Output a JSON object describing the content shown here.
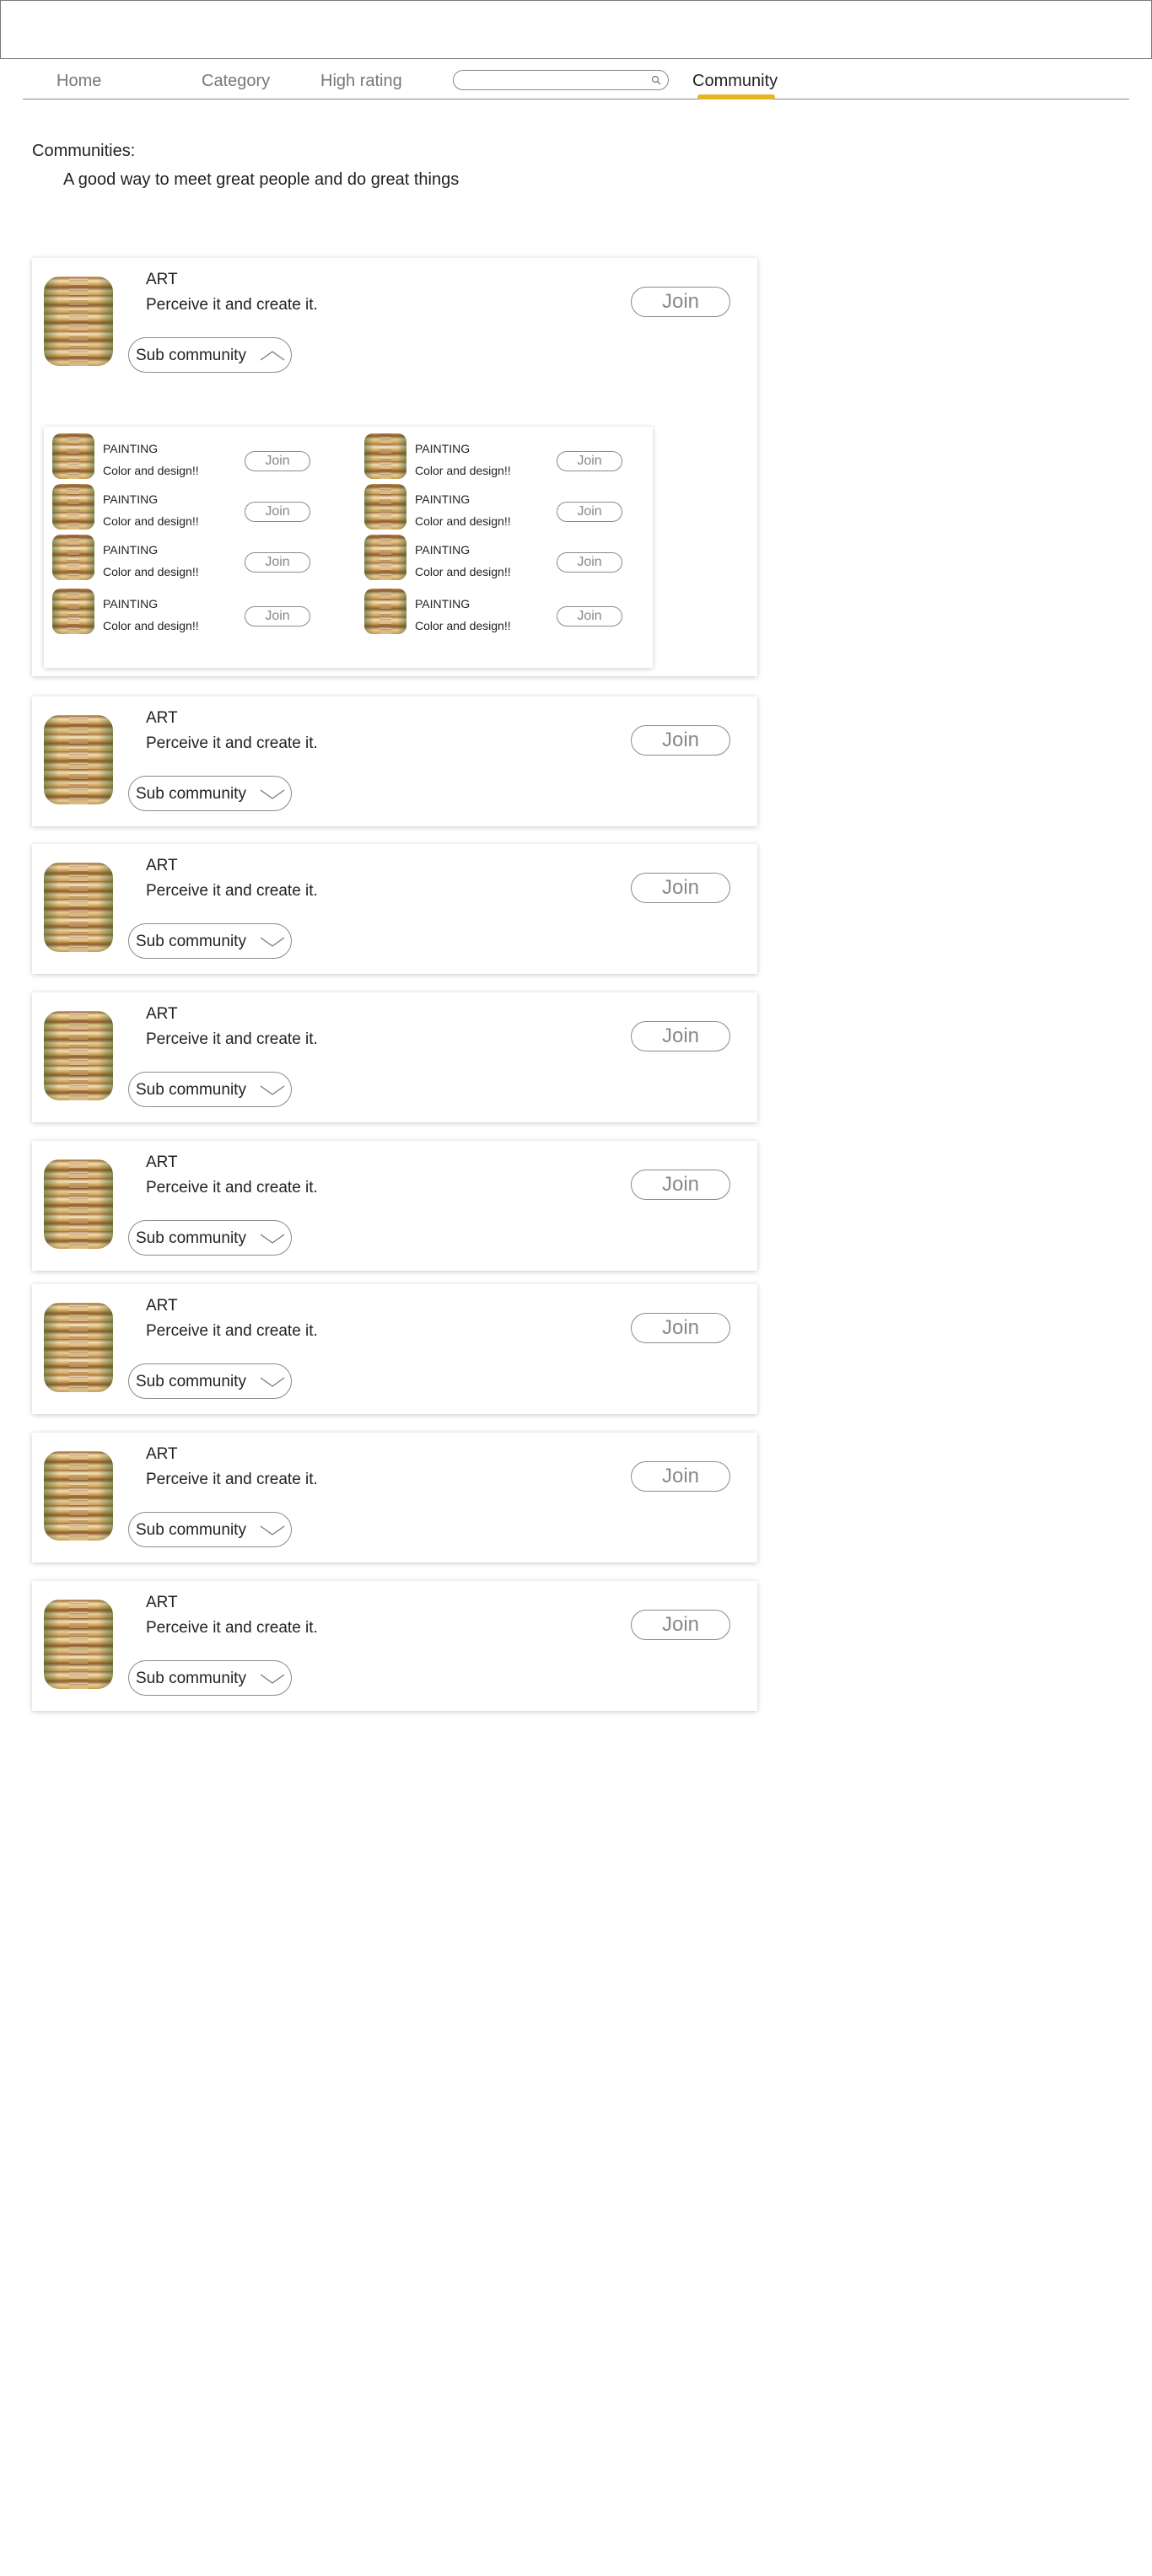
{
  "nav": {
    "items": [
      {
        "label": "Home",
        "name": "nav-home"
      },
      {
        "label": "Category",
        "name": "nav-category"
      },
      {
        "label": "High rating",
        "name": "nav-high-rating"
      },
      {
        "label": "Community",
        "name": "nav-community"
      }
    ],
    "active": "Community",
    "search": {
      "value": "",
      "placeholder": "",
      "icon": "search-icon"
    },
    "accent_color": "#e7b524"
  },
  "page": {
    "title": "Communities:",
    "subtitle": "A good way to meet great people and do great things"
  },
  "communities": [
    {
      "title": "ART",
      "description": "Perceive it and create it.",
      "join_label": "Join",
      "sub_label": "Sub community",
      "expanded": true,
      "chevron": "chevron-up-icon"
    },
    {
      "title": "ART",
      "description": "Perceive it and create it.",
      "join_label": "Join",
      "sub_label": "Sub community",
      "expanded": false,
      "chevron": "chevron-down-icon"
    },
    {
      "title": "ART",
      "description": "Perceive it and create it.",
      "join_label": "Join",
      "sub_label": "Sub community",
      "expanded": false,
      "chevron": "chevron-down-icon"
    },
    {
      "title": "ART",
      "description": "Perceive it and create it.",
      "join_label": "Join",
      "sub_label": "Sub community",
      "expanded": false,
      "chevron": "chevron-down-icon"
    },
    {
      "title": "ART",
      "description": "Perceive it and create it.",
      "join_label": "Join",
      "sub_label": "Sub community",
      "expanded": false,
      "chevron": "chevron-down-icon"
    },
    {
      "title": "ART",
      "description": "Perceive it and create it.",
      "join_label": "Join",
      "sub_label": "Sub community",
      "expanded": false,
      "chevron": "chevron-down-icon"
    },
    {
      "title": "ART",
      "description": "Perceive it and create it.",
      "join_label": "Join",
      "sub_label": "Sub community",
      "expanded": false,
      "chevron": "chevron-down-icon"
    },
    {
      "title": "ART",
      "description": "Perceive it and create it.",
      "join_label": "Join",
      "sub_label": "Sub community",
      "expanded": false,
      "chevron": "chevron-down-icon"
    }
  ],
  "subcommunities": [
    {
      "title": "PAINTING",
      "description": "Color and design!!",
      "join_label": "Join"
    },
    {
      "title": "PAINTING",
      "description": "Color and design!!",
      "join_label": "Join"
    },
    {
      "title": "PAINTING",
      "description": "Color and design!!",
      "join_label": "Join"
    },
    {
      "title": "PAINTING",
      "description": "Color and design!!",
      "join_label": "Join"
    },
    {
      "title": "PAINTING",
      "description": "Color and design!!",
      "join_label": "Join"
    },
    {
      "title": "PAINTING",
      "description": "Color and design!!",
      "join_label": "Join"
    },
    {
      "title": "PAINTING",
      "description": "Color and design!!",
      "join_label": "Join"
    },
    {
      "title": "PAINTING",
      "description": "Color and design!!",
      "join_label": "Join"
    }
  ]
}
